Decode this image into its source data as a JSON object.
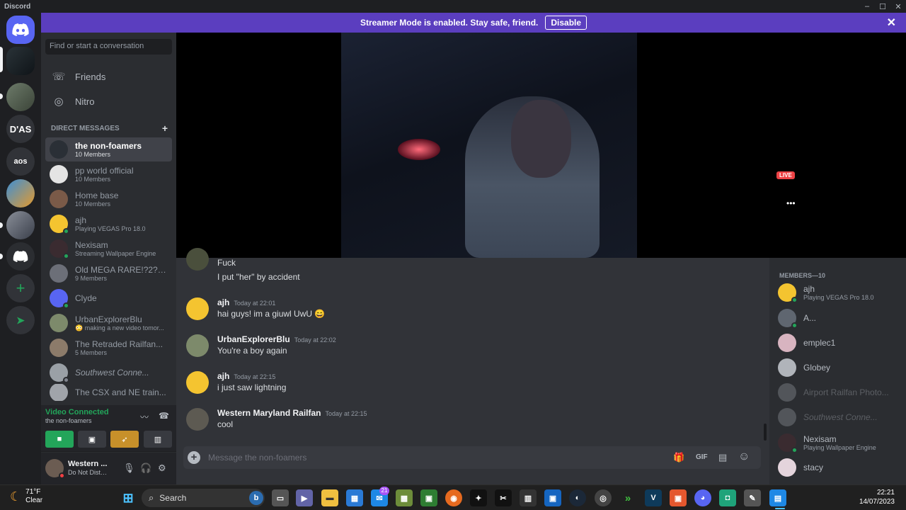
{
  "window": {
    "title": "Discord",
    "controls": [
      "–",
      "☐",
      "✕"
    ]
  },
  "banner": {
    "text": "Streamer Mode is enabled. Stay safe, friend.",
    "disable_label": "Disable",
    "close": "✕"
  },
  "servers": [
    {
      "label": "",
      "name": "home"
    },
    {
      "label": "D'AS",
      "name": "das"
    },
    {
      "label": "aos",
      "name": "aos"
    },
    {
      "add": "+",
      "explore": "➤"
    }
  ],
  "sidebar": {
    "search_placeholder": "Find or start a conversation",
    "friends_label": "Friends",
    "nitro_label": "Nitro",
    "dm_header": "DIRECT MESSAGES",
    "dm_add": "+",
    "dms": [
      {
        "name": "the non-foamers",
        "sub": "10 Members",
        "active": true
      },
      {
        "name": "pp world official",
        "sub": "10 Members"
      },
      {
        "name": "Home base",
        "sub": "10 Members"
      },
      {
        "name": "ajh",
        "sub": "Playing VEGAS Pro 18.0"
      },
      {
        "name": "Nexisam",
        "sub": "Streaming Wallpaper Engine"
      },
      {
        "name": "Old MEGA RARE!?2?2...",
        "sub": "9 Members"
      },
      {
        "name": "Clyde",
        "sub": ""
      },
      {
        "name": "UrbanExplorerBlu",
        "sub": "😳 making a new video tomor..."
      },
      {
        "name": "The Retraded Railfan...",
        "sub": "5 Members"
      },
      {
        "name": "Southwest Conne...",
        "sub": ""
      },
      {
        "name": "The CSX and NE train...",
        "sub": ""
      }
    ]
  },
  "voice": {
    "status": "Video Connected",
    "channel": "the non-foamers"
  },
  "user": {
    "name": "Western ...",
    "status": "Do Not Distu..."
  },
  "stream": {
    "live_label": "LIVE",
    "more": "•••"
  },
  "chat": {
    "messages": [
      {
        "text1": "Fuck",
        "text2": "I put \"her\" by accident"
      },
      {
        "author": "ajh",
        "time": "Today at 22:01",
        "text": "hai guys! im a giuwl UwU 😄"
      },
      {
        "author": "UrbanExplorerBlu",
        "time": "Today at 22:02",
        "text": "You're a boy again"
      },
      {
        "author": "ajh",
        "time": "Today at 22:15",
        "text": "i just saw lightning"
      },
      {
        "author": "Western Maryland Railfan",
        "time": "Today at 22:15",
        "text": "cool"
      }
    ],
    "composer_placeholder": "Message the non-foamers",
    "composer_icons": {
      "gift": "🎁",
      "gif": "GIF",
      "sticker": "▤",
      "emoji": "☺"
    }
  },
  "members": {
    "header": "MEMBERS—10",
    "list": [
      {
        "name": "ajh",
        "sub": "Playing VEGAS Pro 18.0"
      },
      {
        "name": "A...",
        "sub": ""
      },
      {
        "name": "emplec1",
        "sub": ""
      },
      {
        "name": "Globey",
        "sub": ""
      },
      {
        "name": "Airport Railfan Photo...",
        "sub": "",
        "offline": true
      },
      {
        "name": "Southwest Conne...",
        "sub": "",
        "offline": true
      },
      {
        "name": "Nexisam",
        "sub": "Playing Wallpaper Engine"
      },
      {
        "name": "stacy",
        "sub": ""
      }
    ]
  },
  "taskbar": {
    "weather_temp": "71°F",
    "weather_desc": "Clear",
    "search_label": "Search",
    "badge": "21",
    "time": "22:21",
    "date": "14/07/2023"
  },
  "colors": {
    "accent": "#5865f2",
    "banner": "#5b3ebf",
    "online": "#23a55a",
    "dnd": "#f23f43",
    "idle": "#f0b232"
  }
}
